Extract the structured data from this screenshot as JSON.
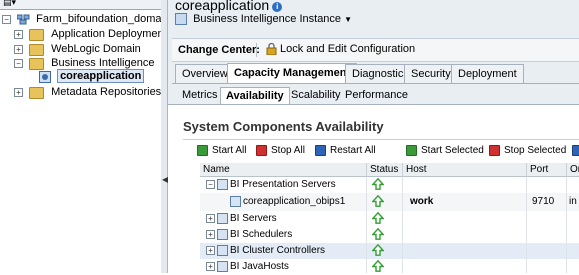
{
  "tree": {
    "root_label": "Farm_bifoundation_domain",
    "items": [
      {
        "label": "Application Deployments"
      },
      {
        "label": "WebLogic Domain"
      },
      {
        "label": "Business Intelligence"
      },
      {
        "label": "coreapplication"
      },
      {
        "label": "Metadata Repositories"
      }
    ]
  },
  "header": {
    "title": "coreapplication",
    "instance_menu": "Business Intelligence Instance"
  },
  "change_center": {
    "label": "Change Center:",
    "lock_button": "Lock and Edit Configuration"
  },
  "tabs": [
    "Overview",
    "Capacity Management",
    "Diagnostics",
    "Security",
    "Deployment"
  ],
  "subtabs": [
    "Metrics",
    "Availability",
    "Scalability",
    "Performance"
  ],
  "section": {
    "title": "System Components Availability"
  },
  "toolbar": {
    "start_all": "Start All",
    "stop_all": "Stop All",
    "restart_all": "Restart All",
    "start_selected": "Start Selected",
    "stop_selected": "Stop Selected"
  },
  "table": {
    "columns": [
      "Name",
      "Status",
      "Host",
      "Port",
      "Or"
    ],
    "rows": [
      {
        "name": "BI Presentation Servers",
        "host": "",
        "port": "",
        "extra": ""
      },
      {
        "name": "coreapplication_obips1",
        "host": "work",
        "port": "9710",
        "extra": "in"
      },
      {
        "name": "BI Servers",
        "host": "",
        "port": "",
        "extra": ""
      },
      {
        "name": "BI Schedulers",
        "host": "",
        "port": "",
        "extra": ""
      },
      {
        "name": "BI Cluster Controllers",
        "host": "",
        "port": "",
        "extra": ""
      },
      {
        "name": "BI JavaHosts",
        "host": "",
        "port": "",
        "extra": ""
      }
    ]
  },
  "colors": {
    "status_up": "#33a033",
    "selected_tab_bg": "#ffffff",
    "panel_bg": "#e9eef3"
  }
}
